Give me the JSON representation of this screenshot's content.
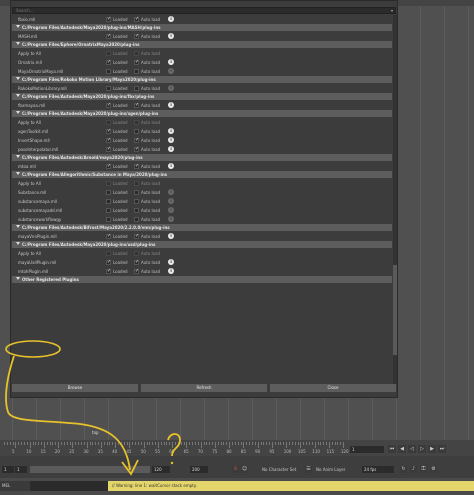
{
  "background_menu": [
    "Filter",
    "Help"
  ],
  "filter": {
    "placeholder": "Search...",
    "dropdown": "▾"
  },
  "columns": {
    "loaded": "Loaded",
    "auto_load": "Auto load"
  },
  "plugin_rows": [
    {
      "type": "row",
      "name": "fbxio.mll",
      "loaded": true,
      "auto": true,
      "info": true
    },
    {
      "type": "section",
      "label": "C:/Program Files/Autodesk/Maya2020/plug-ins/MASH/plug-ins"
    },
    {
      "type": "row",
      "name": "MASH.mll",
      "loaded": true,
      "auto": true,
      "info": true
    },
    {
      "type": "section",
      "label": "C:/Program Files/Ephere/OrnatrixMaya2020/plug-ins"
    },
    {
      "type": "row",
      "name": "Apply to All",
      "apply": true
    },
    {
      "type": "row",
      "name": "Ornatrix.mll",
      "loaded": true,
      "auto": true,
      "info": true
    },
    {
      "type": "row",
      "name": "MayaOrnatrixMaya.mll",
      "loaded": false,
      "auto": false,
      "info": false
    },
    {
      "type": "section",
      "label": "C:/Program Files/Rokoko Motion Library/Maya2020/plug-ins"
    },
    {
      "type": "row",
      "name": "RokokoMotionLibrary.mll",
      "loaded": false,
      "auto": false,
      "info": false
    },
    {
      "type": "section",
      "label": "C:/Program Files/Autodesk/Maya2020/plug-ins/fbx/plug-ins"
    },
    {
      "type": "row",
      "name": "fbxmayaa.mll",
      "loaded": true,
      "auto": true,
      "info": true
    },
    {
      "type": "section",
      "label": "C:/Program Files/Autodesk/Maya2020/plug-ins/xgen/plug-ins"
    },
    {
      "type": "row",
      "name": "Apply to All",
      "apply": true
    },
    {
      "type": "row",
      "name": "xgenToolkit.mll",
      "loaded": true,
      "auto": false,
      "info": true
    },
    {
      "type": "row",
      "name": "InvertShape.mll",
      "loaded": true,
      "auto": true,
      "info": true
    },
    {
      "type": "row",
      "name": "poseInterpolator.mll",
      "loaded": true,
      "auto": true,
      "info": true
    },
    {
      "type": "section",
      "label": "C:/Program Files/Autodesk/Arnold/maya2020/plug-ins"
    },
    {
      "type": "row",
      "name": "mtoa.mll",
      "loaded": true,
      "auto": true,
      "info": true
    },
    {
      "type": "section",
      "label": "C:/Program Files/Allegorithmic/Substance in Maya/2020/plug-ins"
    },
    {
      "type": "row",
      "name": "Apply to All",
      "apply": true
    },
    {
      "type": "row",
      "name": "Substance.mll",
      "loaded": false,
      "auto": false,
      "info": false
    },
    {
      "type": "row",
      "name": "substancemaya.mll",
      "loaded": false,
      "auto": false,
      "info": false
    },
    {
      "type": "row",
      "name": "substancemayadd.mll",
      "loaded": false,
      "auto": false,
      "info": false
    },
    {
      "type": "row",
      "name": "substanceworkflowgy",
      "loaded": false,
      "auto": false,
      "info": false
    },
    {
      "type": "section",
      "label": "C:/Program Files/Autodesk/Bifrost/Maya2020/2.2.0.0/vnn/plug-ins"
    },
    {
      "type": "row",
      "name": "mayaVnnPlugin.mll",
      "loaded": true,
      "auto": true,
      "info": true
    },
    {
      "type": "section",
      "label": "C:/Program Files/Autodesk/Maya2020/plug-ins/usd/plug-ins"
    },
    {
      "type": "row",
      "name": "Apply to All",
      "apply": true
    },
    {
      "type": "row",
      "name": "mayaUsdPlugin.mll",
      "loaded": true,
      "auto": true,
      "info": true
    },
    {
      "type": "row",
      "name": "mtohPlugin.mll",
      "loaded": true,
      "auto": true,
      "info": true
    },
    {
      "type": "section",
      "label": "Other Registered Plugins"
    }
  ],
  "dialog_buttons": {
    "browse": "Browse",
    "refresh": "Refresh",
    "close": "Close"
  },
  "timeline": {
    "ticks": [
      "5",
      "10",
      "15",
      "20",
      "25",
      "30",
      "35",
      "40",
      "45",
      "50",
      "55",
      "60",
      "65",
      "70",
      "75",
      "80",
      "85",
      "90",
      "95",
      "100",
      "105",
      "110",
      "115",
      "120"
    ],
    "frame": "1",
    "top_label": "top"
  },
  "range": {
    "start": "1",
    "start2": "1",
    "end": "120",
    "end2": "200",
    "character_set": "No Character Set",
    "anim_layer": "No Anim Layer",
    "fps": "24 fps"
  },
  "script": {
    "label": "MEL",
    "status": "// Warning: line 1: waitCursor stack empty."
  },
  "annotation_color": "#e8c22a",
  "highlight_color": "#e4d66a"
}
